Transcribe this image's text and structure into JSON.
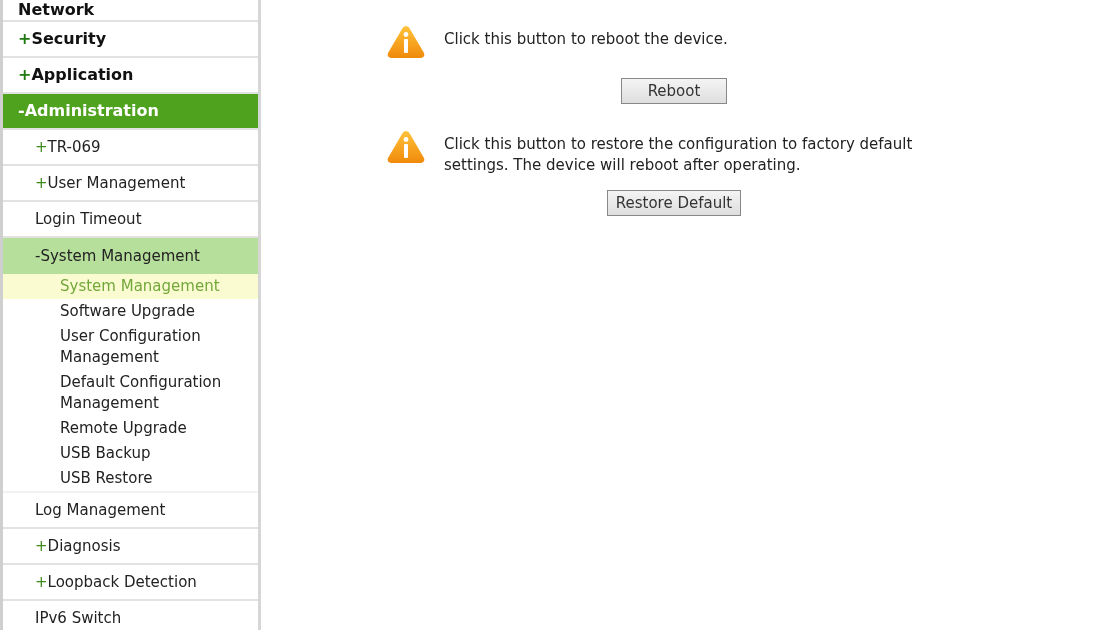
{
  "sidebar": {
    "items": [
      {
        "label": "Network",
        "selected": false
      },
      {
        "prefix": "+",
        "label": "Security",
        "selected": false
      },
      {
        "prefix": "+",
        "label": "Application",
        "selected": false
      },
      {
        "prefix": "-",
        "label": "Administration",
        "selected": true,
        "children": [
          {
            "prefix": "+",
            "label": "TR-069",
            "selected": false
          },
          {
            "prefix": "+",
            "label": "User Management",
            "selected": false
          },
          {
            "label": "Login Timeout",
            "selected": false
          },
          {
            "prefix": "-",
            "label": "System Management",
            "selected": true,
            "children": [
              {
                "label": "System Management",
                "selected": true
              },
              {
                "label": "Software Upgrade",
                "selected": false
              },
              {
                "label": "User Configuration Management",
                "selected": false
              },
              {
                "label": "Default Configuration Management",
                "selected": false
              },
              {
                "label": "Remote Upgrade",
                "selected": false
              },
              {
                "label": "USB Backup",
                "selected": false
              },
              {
                "label": "USB Restore",
                "selected": false
              }
            ]
          },
          {
            "label": "Log Management",
            "selected": false
          },
          {
            "prefix": "+",
            "label": "Diagnosis",
            "selected": false
          },
          {
            "prefix": "+",
            "label": "Loopback Detection",
            "selected": false
          },
          {
            "label": "IPv6 Switch",
            "selected": false
          }
        ]
      }
    ]
  },
  "notices": [
    {
      "text": "Click this button to reboot the device.",
      "button": "Reboot"
    },
    {
      "text": "Click this button to restore the configuration to factory default settings. The device will reboot after operating.",
      "button": "Restore Default"
    }
  ]
}
